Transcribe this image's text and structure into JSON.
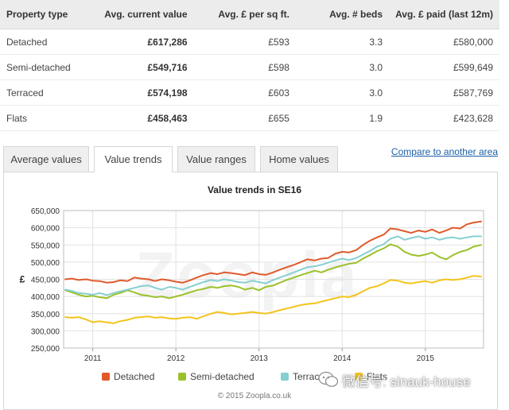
{
  "table": {
    "headers": [
      "Property type",
      "Avg. current value",
      "Avg. £ per sq ft.",
      "Avg. # beds",
      "Avg. £ paid (last 12m)"
    ],
    "rows": [
      [
        "Detached",
        "£617,286",
        "£593",
        "3.3",
        "£580,000"
      ],
      [
        "Semi-detached",
        "£549,716",
        "£598",
        "3.0",
        "£599,649"
      ],
      [
        "Terraced",
        "£574,198",
        "£603",
        "3.0",
        "£587,769"
      ],
      [
        "Flats",
        "£458,463",
        "£655",
        "1.9",
        "£423,628"
      ]
    ]
  },
  "tabs": [
    {
      "label": "Average values",
      "active": false
    },
    {
      "label": "Value trends",
      "active": true
    },
    {
      "label": "Value ranges",
      "active": false
    },
    {
      "label": "Home values",
      "active": false
    }
  ],
  "compare_link": "Compare to another area",
  "watermark_text": "Zoopla",
  "copyright": "© 2015 Zoopla.co.uk",
  "overlay_text": "微信号: sinauk-house",
  "chart_data": {
    "type": "line",
    "title": "Value trends in SE16",
    "ylabel": "£",
    "xlabel": "",
    "ylim": [
      250000,
      650000
    ],
    "yticks": [
      250000,
      300000,
      350000,
      400000,
      450000,
      500000,
      550000,
      600000,
      650000
    ],
    "ytick_labels": [
      "250,000",
      "300,000",
      "350,000",
      "400,000",
      "450,000",
      "500,000",
      "550,000",
      "600,000",
      "650,000"
    ],
    "xlim": [
      2010.65,
      2015.7
    ],
    "xticks": [
      2011,
      2012,
      2013,
      2014,
      2015
    ],
    "xtick_labels": [
      "2011",
      "2012",
      "2013",
      "2014",
      "2015"
    ],
    "x": [
      2010.67,
      2010.75,
      2010.83,
      2010.92,
      2011.0,
      2011.08,
      2011.17,
      2011.25,
      2011.33,
      2011.42,
      2011.5,
      2011.58,
      2011.67,
      2011.75,
      2011.83,
      2011.92,
      2012.0,
      2012.08,
      2012.17,
      2012.25,
      2012.33,
      2012.42,
      2012.5,
      2012.58,
      2012.67,
      2012.75,
      2012.83,
      2012.92,
      2013.0,
      2013.08,
      2013.17,
      2013.25,
      2013.33,
      2013.42,
      2013.5,
      2013.58,
      2013.67,
      2013.75,
      2013.83,
      2013.92,
      2014.0,
      2014.08,
      2014.17,
      2014.25,
      2014.33,
      2014.42,
      2014.5,
      2014.58,
      2014.67,
      2014.75,
      2014.83,
      2014.92,
      2015.0,
      2015.08,
      2015.17,
      2015.25,
      2015.33,
      2015.42,
      2015.5,
      2015.58,
      2015.67
    ],
    "series": [
      {
        "name": "Detached",
        "color": "#e05a2b",
        "values": [
          450000,
          452000,
          448000,
          450000,
          446000,
          445000,
          440000,
          442000,
          447000,
          445000,
          455000,
          452000,
          450000,
          445000,
          450000,
          447000,
          443000,
          440000,
          447000,
          455000,
          462000,
          468000,
          465000,
          470000,
          468000,
          465000,
          462000,
          470000,
          465000,
          463000,
          470000,
          478000,
          485000,
          492000,
          500000,
          508000,
          505000,
          510000,
          512000,
          525000,
          530000,
          528000,
          535000,
          550000,
          562000,
          572000,
          580000,
          598000,
          595000,
          590000,
          585000,
          592000,
          588000,
          595000,
          585000,
          592000,
          600000,
          598000,
          610000,
          615000,
          618000
        ]
      },
      {
        "name": "Semi-detached",
        "color": "#9bc12a",
        "values": [
          418000,
          412000,
          405000,
          400000,
          402000,
          398000,
          395000,
          405000,
          410000,
          418000,
          412000,
          405000,
          402000,
          398000,
          400000,
          395000,
          400000,
          405000,
          412000,
          418000,
          422000,
          428000,
          425000,
          430000,
          432000,
          428000,
          420000,
          425000,
          418000,
          428000,
          432000,
          440000,
          448000,
          455000,
          462000,
          468000,
          475000,
          470000,
          478000,
          485000,
          490000,
          495000,
          498000,
          510000,
          520000,
          532000,
          540000,
          552000,
          545000,
          530000,
          522000,
          518000,
          522000,
          528000,
          515000,
          508000,
          520000,
          530000,
          535000,
          545000,
          550000
        ]
      },
      {
        "name": "Terraced",
        "color": "#86cfd0",
        "values": [
          420000,
          416000,
          410000,
          408000,
          405000,
          410000,
          404000,
          410000,
          415000,
          420000,
          425000,
          430000,
          432000,
          425000,
          420000,
          428000,
          425000,
          420000,
          428000,
          435000,
          442000,
          448000,
          445000,
          450000,
          446000,
          442000,
          440000,
          446000,
          442000,
          438000,
          448000,
          455000,
          462000,
          470000,
          478000,
          485000,
          488000,
          492000,
          498000,
          505000,
          510000,
          506000,
          512000,
          522000,
          532000,
          545000,
          552000,
          568000,
          575000,
          565000,
          570000,
          575000,
          568000,
          572000,
          565000,
          570000,
          572000,
          568000,
          572000,
          575000,
          575000
        ]
      },
      {
        "name": "Flats",
        "color": "#f3c41d",
        "values": [
          340000,
          338000,
          340000,
          333000,
          325000,
          328000,
          325000,
          322000,
          328000,
          332000,
          338000,
          340000,
          342000,
          338000,
          340000,
          336000,
          335000,
          338000,
          340000,
          335000,
          342000,
          350000,
          355000,
          352000,
          348000,
          350000,
          352000,
          355000,
          352000,
          350000,
          355000,
          360000,
          365000,
          370000,
          375000,
          378000,
          380000,
          385000,
          390000,
          395000,
          400000,
          398000,
          405000,
          415000,
          425000,
          430000,
          438000,
          448000,
          446000,
          440000,
          438000,
          442000,
          445000,
          440000,
          447000,
          450000,
          448000,
          450000,
          455000,
          460000,
          458000
        ]
      }
    ],
    "grid": true,
    "legend": "bottom"
  }
}
